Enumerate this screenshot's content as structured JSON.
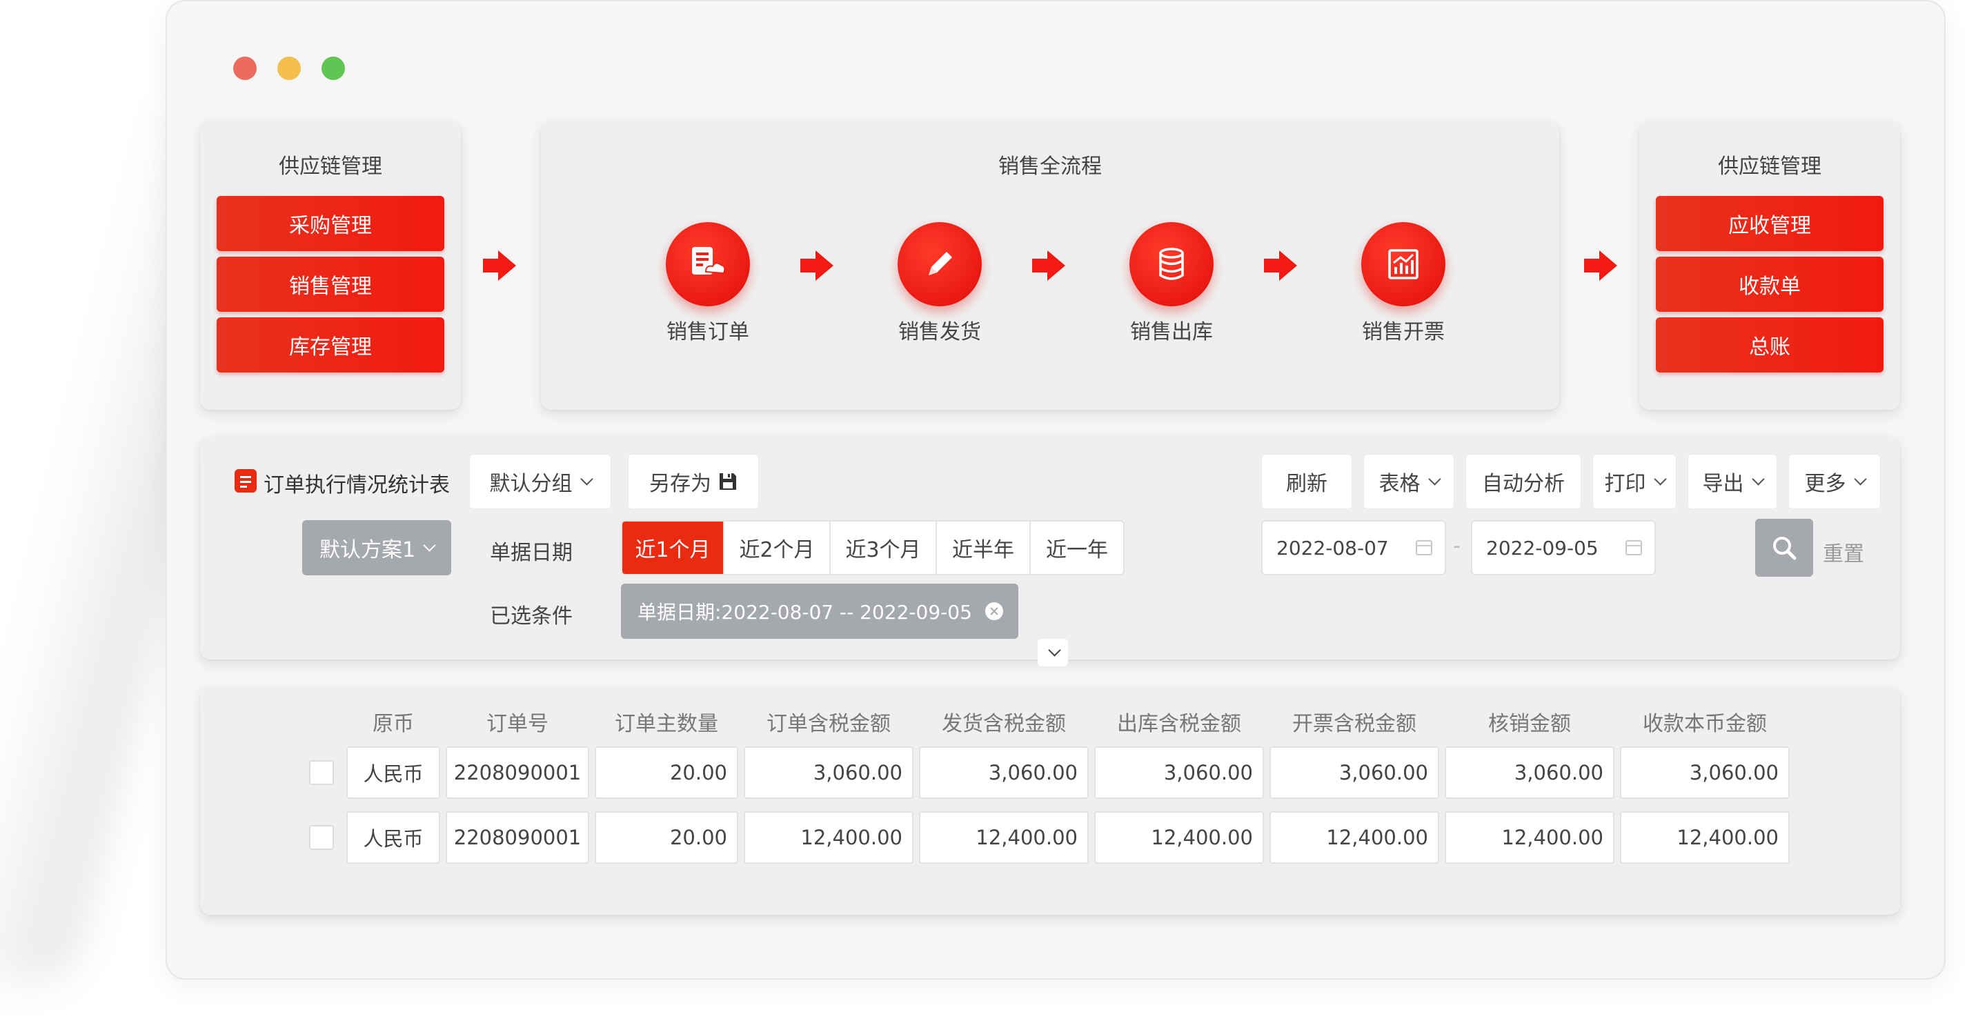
{
  "window": {
    "controls": [
      "close",
      "minimize",
      "maximize"
    ]
  },
  "left_panel": {
    "title": "供应链管理",
    "items": [
      "采购管理",
      "销售管理",
      "库存管理"
    ]
  },
  "flow_panel": {
    "title": "销售全流程",
    "steps": [
      {
        "label": "销售订单",
        "icon": "sales-order-icon"
      },
      {
        "label": "销售发货",
        "icon": "pencil-icon"
      },
      {
        "label": "销售出库",
        "icon": "database-icon"
      },
      {
        "label": "销售开票",
        "icon": "chart-icon"
      }
    ]
  },
  "right_panel": {
    "title": "供应链管理",
    "items": [
      "应收管理",
      "收款单",
      "总账"
    ]
  },
  "colors": {
    "accent": "#ea2b12",
    "gray_button": "#a5a8ad",
    "panel": "#efefef"
  },
  "filter": {
    "report_title": "订单执行情况统计表",
    "group_button": "默认分组",
    "save_as_button": "另存为",
    "toolbar": [
      "刷新",
      "表格",
      "自动分析",
      "打印",
      "导出",
      "更多"
    ],
    "plan_button": "默认方案1",
    "date_label": "单据日期",
    "date_options": [
      "近1个月",
      "近2个月",
      "近3个月",
      "近半年",
      "近一年"
    ],
    "active_date_option": "近1个月",
    "date_from": "2022-08-07",
    "date_to": "2022-09-05",
    "date_separator": "-",
    "reset_label": "重置",
    "selected_label": "已选条件",
    "selected_chip": "单据日期:2022-08-07 -- 2022-09-05"
  },
  "table": {
    "headers": [
      "原币",
      "订单号",
      "订单主数量",
      "订单含税金额",
      "发货含税金额",
      "出库含税金额",
      "开票含税金额",
      "核销金额",
      "收款本币金额"
    ],
    "rows": [
      [
        "人民币",
        "2208090001",
        "20.00",
        "3,060.00",
        "3,060.00",
        "3,060.00",
        "3,060.00",
        "3,060.00",
        "3,060.00"
      ],
      [
        "人民币",
        "2208090001",
        "20.00",
        "12,400.00",
        "12,400.00",
        "12,400.00",
        "12,400.00",
        "12,400.00",
        "12,400.00"
      ]
    ]
  }
}
